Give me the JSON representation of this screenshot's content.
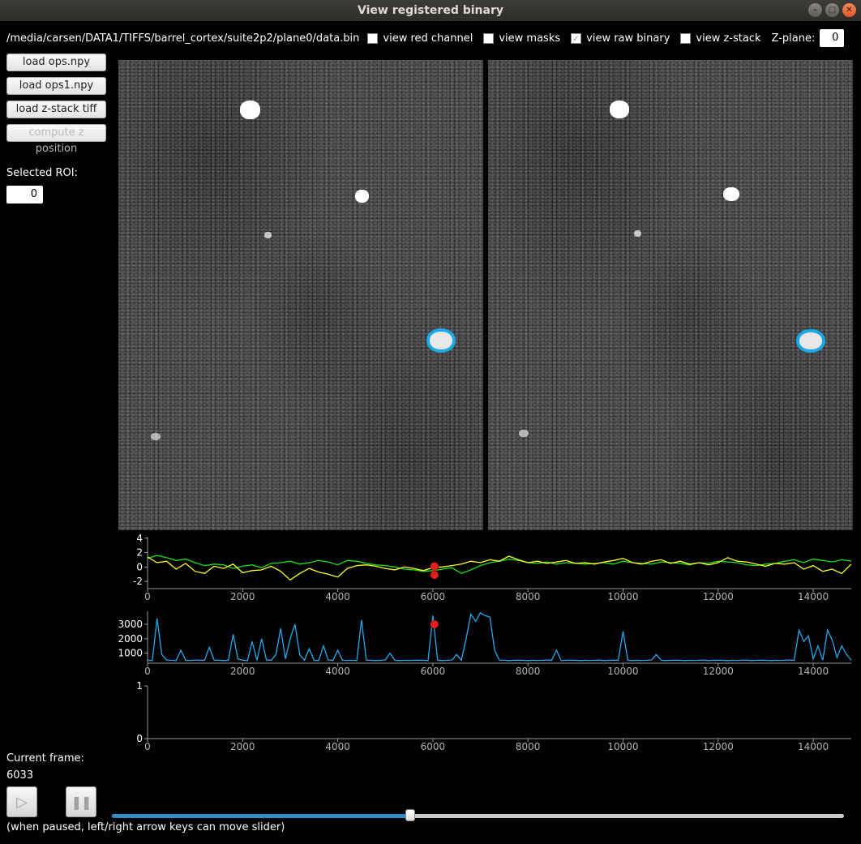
{
  "window": {
    "title": "View registered binary",
    "controls": [
      "–",
      "□",
      "✕"
    ]
  },
  "toolbar": {
    "path": "/media/carsen/DATA1/TIFFS/barrel_cortex/suite2p2/plane0/data.bin",
    "checkboxes": [
      {
        "label": "view red channel",
        "checked": false
      },
      {
        "label": "view masks",
        "checked": false
      },
      {
        "label": "view raw binary",
        "checked": true
      },
      {
        "label": "view z-stack",
        "checked": false
      }
    ],
    "zplane_label": "Z-plane:",
    "zplane_value": "0"
  },
  "sidebar": {
    "buttons": [
      {
        "label": "load ops.npy",
        "enabled": true
      },
      {
        "label": "load ops1.npy",
        "enabled": true
      },
      {
        "label": "load z-stack tiff",
        "enabled": true
      },
      {
        "label": "compute z position",
        "enabled": false
      }
    ],
    "selected_roi_label": "Selected ROI:",
    "selected_roi_value": "0"
  },
  "frame": {
    "label": "Current frame:",
    "value": "6033",
    "hint": "(when paused, left/right arrow keys can move slider)",
    "slider_fraction": 0.408
  },
  "icons": {
    "play": "play-icon",
    "pause": "pause-icon"
  },
  "colors": {
    "trace_green": "#16e016",
    "trace_yellow": "#ffff1a",
    "trace_blue": "#22a8ee",
    "marker_red": "#e02020",
    "roi_blue": "#19a8e8"
  },
  "chart_data": [
    {
      "type": "line",
      "x": [
        0,
        200,
        400,
        600,
        800,
        1000,
        1200,
        1400,
        1600,
        1800,
        2000,
        2200,
        2400,
        2600,
        2800,
        3000,
        3200,
        3400,
        3600,
        3800,
        4000,
        4200,
        4400,
        4600,
        4800,
        5000,
        5200,
        5400,
        5600,
        5800,
        6000,
        6200,
        6400,
        6600,
        6800,
        7000,
        7200,
        7400,
        7600,
        7800,
        8000,
        8200,
        8400,
        8600,
        8800,
        9000,
        9200,
        9400,
        9600,
        9800,
        10000,
        10200,
        10400,
        10600,
        10800,
        11000,
        11200,
        11400,
        11600,
        11800,
        12000,
        12200,
        12400,
        12600,
        12800,
        13000,
        13200,
        13400,
        13600,
        13800,
        14000,
        14200,
        14400,
        14600,
        14800
      ],
      "series": [
        {
          "color": "#16e016",
          "values": [
            1.2,
            1.6,
            1.3,
            0.9,
            1.1,
            0.6,
            0.2,
            0.4,
            0.3,
            -0.2,
            0.1,
            0.3,
            -0.1,
            0.5,
            0.6,
            0.8,
            0.4,
            0.6,
            0.9,
            0.7,
            0.3,
            0.9,
            0.8,
            0.5,
            0.3,
            0.2,
            0.0,
            -0.3,
            -0.4,
            -0.6,
            -0.5,
            -0.3,
            -0.1,
            -0.9,
            -0.4,
            0.2,
            0.6,
            0.8,
            1.1,
            0.9,
            0.6,
            0.5,
            0.7,
            0.4,
            0.6,
            0.5,
            0.4,
            0.5,
            0.6,
            0.4,
            0.8,
            0.6,
            0.5,
            0.4,
            0.7,
            0.6,
            0.5,
            0.3,
            0.6,
            0.5,
            0.8,
            0.7,
            0.6,
            0.3,
            0.2,
            0.4,
            0.5,
            0.8,
            1.0,
            0.6,
            1.1,
            0.9,
            0.7,
            1.0,
            0.8
          ]
        },
        {
          "color": "#ffff1a",
          "values": [
            1.4,
            0.6,
            0.8,
            -0.3,
            0.5,
            -0.6,
            -0.9,
            0.1,
            -0.2,
            0.4,
            -0.8,
            -0.5,
            -0.4,
            0.1,
            -0.6,
            -1.8,
            -0.9,
            -0.2,
            -0.7,
            -1.0,
            -1.4,
            -0.2,
            0.2,
            0.3,
            0.1,
            -0.2,
            -0.4,
            0.0,
            -0.2,
            -0.5,
            -0.1,
            0.0,
            0.2,
            0.4,
            0.8,
            0.6,
            1.0,
            0.8,
            1.5,
            1.0,
            0.6,
            0.8,
            0.5,
            0.7,
            0.9,
            0.5,
            0.6,
            0.4,
            0.7,
            0.9,
            1.2,
            0.6,
            0.4,
            0.8,
            1.0,
            0.5,
            0.8,
            0.4,
            0.6,
            0.3,
            0.6,
            1.3,
            0.8,
            0.7,
            0.4,
            0.1,
            0.5,
            0.4,
            0.6,
            -0.3,
            0.2,
            -0.6,
            -0.3,
            -0.9,
            0.4
          ]
        }
      ],
      "markers": [
        {
          "x": 6033,
          "y": 0.1
        },
        {
          "x": 6033,
          "y": -1.1
        }
      ],
      "xlim": [
        0,
        14800
      ],
      "ylim": [
        -3,
        4.2
      ],
      "xticks": [
        0,
        2000,
        4000,
        6000,
        8000,
        10000,
        12000,
        14000
      ],
      "yticks": [
        4,
        2,
        0,
        -2
      ]
    },
    {
      "type": "line",
      "x": [
        0,
        100,
        200,
        300,
        400,
        500,
        600,
        700,
        800,
        900,
        1000,
        1100,
        1200,
        1300,
        1400,
        1500,
        1600,
        1700,
        1800,
        1900,
        2000,
        2100,
        2200,
        2300,
        2400,
        2500,
        2600,
        2700,
        2800,
        2900,
        3000,
        3100,
        3200,
        3300,
        3400,
        3500,
        3600,
        3700,
        3800,
        3900,
        4000,
        4100,
        4200,
        4300,
        4400,
        4500,
        4600,
        4700,
        4800,
        4900,
        5000,
        5100,
        5200,
        5300,
        5400,
        5500,
        5600,
        5700,
        5800,
        5900,
        6000,
        6100,
        6200,
        6300,
        6400,
        6500,
        6600,
        6700,
        6800,
        6900,
        7000,
        7100,
        7200,
        7300,
        7400,
        7500,
        7600,
        7700,
        7800,
        7900,
        8000,
        8100,
        8200,
        8300,
        8400,
        8500,
        8600,
        8700,
        8800,
        8900,
        9000,
        9100,
        9200,
        9300,
        9400,
        9500,
        9600,
        9700,
        9800,
        9900,
        10000,
        10100,
        10200,
        10300,
        10400,
        10500,
        10600,
        10700,
        10800,
        10900,
        11000,
        11100,
        11200,
        11300,
        11400,
        11500,
        11600,
        11700,
        11800,
        11900,
        12000,
        12100,
        12200,
        12300,
        12400,
        12500,
        12600,
        12700,
        12800,
        12900,
        13000,
        13100,
        13200,
        13300,
        13400,
        13500,
        13600,
        13700,
        13800,
        13900,
        14000,
        14100,
        14200,
        14300,
        14400,
        14500,
        14600,
        14700,
        14800
      ],
      "series": [
        {
          "color": "#22a8ee",
          "values": [
            500,
            480,
            3400,
            900,
            520,
            500,
            480,
            1200,
            500,
            490,
            520,
            500,
            510,
            1400,
            520,
            500,
            480,
            500,
            2300,
            600,
            500,
            480,
            1800,
            500,
            2000,
            520,
            500,
            900,
            2700,
            600,
            2000,
            3000,
            900,
            500,
            1300,
            500,
            480,
            1500,
            520,
            500,
            1200,
            500,
            490,
            500,
            480,
            3300,
            510,
            500,
            480,
            500,
            520,
            1000,
            500,
            480,
            500,
            490,
            500,
            510,
            500,
            480,
            3600,
            500,
            480,
            500,
            520,
            900,
            500,
            2000,
            3700,
            3200,
            3800,
            3600,
            3500,
            1200,
            520,
            500,
            480,
            500,
            510,
            500,
            480,
            500,
            490,
            500,
            520,
            500,
            1200,
            480,
            500,
            510,
            500,
            480,
            500,
            490,
            500,
            520,
            480,
            500,
            510,
            500,
            2500,
            500,
            480,
            500,
            490,
            500,
            520,
            900,
            500,
            480,
            500,
            510,
            500,
            480,
            500,
            490,
            500,
            520,
            480,
            500,
            510,
            500,
            480,
            500,
            490,
            500,
            520,
            480,
            500,
            510,
            500,
            480,
            500,
            490,
            500,
            520,
            500,
            2600,
            1800,
            2200,
            600,
            1500,
            500,
            2600,
            1900,
            700,
            1500,
            900,
            500,
            1800,
            500
          ]
        }
      ],
      "markers": [
        {
          "x": 6033,
          "y": 3000
        }
      ],
      "xlim": [
        0,
        14800
      ],
      "ylim": [
        300,
        3900
      ],
      "xticks": [
        0,
        2000,
        4000,
        6000,
        8000,
        10000,
        12000,
        14000
      ],
      "yticks": [
        3000,
        2000,
        1000
      ]
    },
    {
      "type": "line",
      "x": [],
      "series": [],
      "xlim": [
        0,
        14800
      ],
      "ylim": [
        0,
        1
      ],
      "xticks": [
        0,
        2000,
        4000,
        6000,
        8000,
        10000,
        12000,
        14000
      ],
      "yticks": [
        1,
        0
      ]
    }
  ]
}
